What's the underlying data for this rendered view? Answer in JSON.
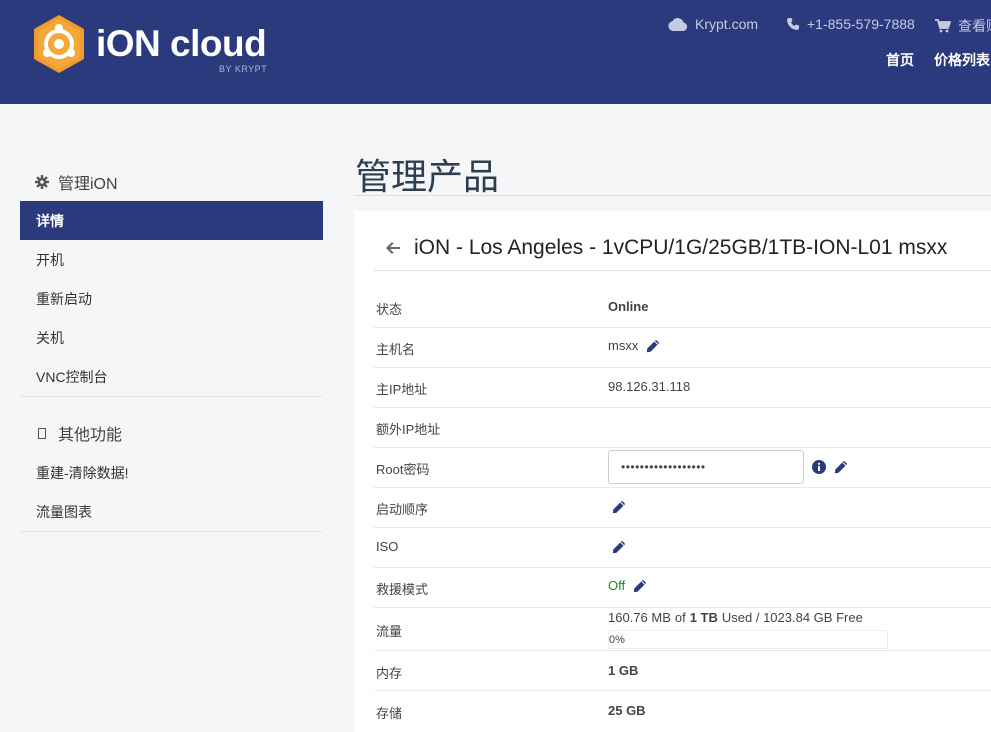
{
  "brand": {
    "name": "iON cloud",
    "sub": "BY KRYPT"
  },
  "top_links": [
    {
      "icon": "cloud-icon",
      "label": "Krypt.com"
    },
    {
      "icon": "phone-icon",
      "label": "+1-855-579-7888"
    },
    {
      "icon": "cart-icon",
      "label": "查看购"
    }
  ],
  "main_nav": [
    "首页",
    "价格列表"
  ],
  "sidebar": {
    "manage_heading": "管理iON",
    "manage_items": [
      "详情",
      "开机",
      "重新启动",
      "关机",
      "VNC控制台"
    ],
    "other_heading": "其他功能",
    "other_items": [
      "重建-清除数据!",
      "流量图表"
    ]
  },
  "page_title": "管理产品",
  "product": {
    "title": "iON - Los Angeles - 1vCPU/1G/25GB/1TB-ION-L01 msxx",
    "rows": {
      "status_label": "状态",
      "status_value": "Online",
      "hostname_label": "主机名",
      "hostname_value": "msxx",
      "ip_label": "主IP地址",
      "ip_value": "98.126.31.118",
      "extra_ip_label": "额外IP地址",
      "root_label": "Root密码",
      "root_value": "••••••••••••••••••",
      "boot_label": "启动顺序",
      "iso_label": "ISO",
      "rescue_label": "救援模式",
      "rescue_value": "Off",
      "traffic_label": "流量",
      "traffic_used": "160.76 MB",
      "traffic_of": "of",
      "traffic_total": "1 TB",
      "traffic_rest": "Used / 1023.84 GB Free",
      "traffic_percent": "0%",
      "memory_label": "内存",
      "memory_value": "1 GB",
      "storage_label": "存储",
      "storage_value": "25 GB"
    }
  },
  "colors": {
    "header": "#2b3a7c",
    "logo_orange": "#f39a2c",
    "online": "#1a8a1a"
  }
}
